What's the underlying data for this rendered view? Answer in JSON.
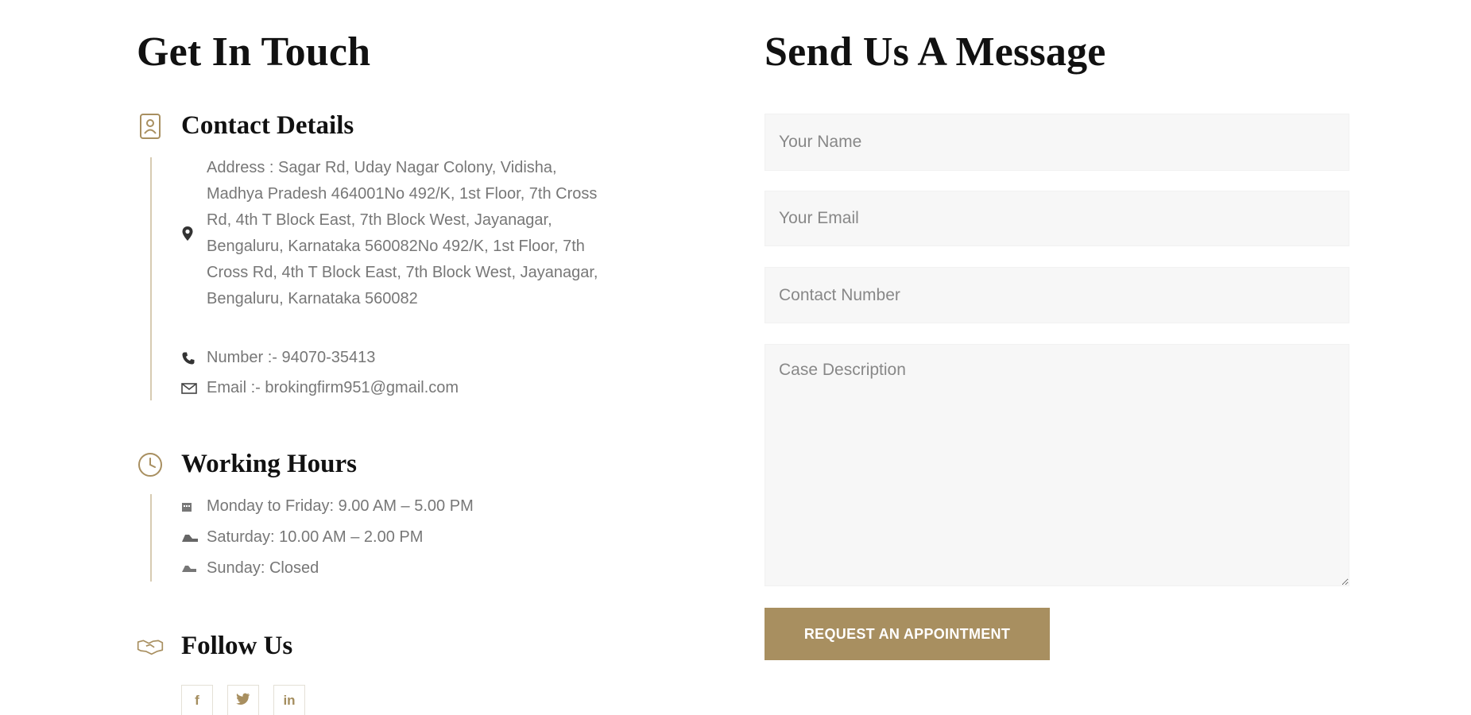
{
  "left": {
    "title": "Get In Touch",
    "contact": {
      "heading": "Contact Details",
      "address": "Address : Sagar Rd, Uday Nagar Colony, Vidisha, Madhya Pradesh 464001No 492/K, 1st Floor, 7th Cross Rd, 4th T Block East, 7th Block West, Jayanagar, Bengaluru, Karnataka 560082No 492/K, 1st Floor, 7th Cross Rd, 4th T Block East, 7th Block West, Jayanagar, Bengaluru, Karnataka 560082",
      "phone": "Number :- 94070-35413",
      "email": "Email :- brokingfirm951@gmail.com"
    },
    "hours": {
      "heading": "Working Hours",
      "items": [
        "Monday to Friday: 9.00 AM – 5.00 PM",
        "Saturday: 10.00 AM – 2.00 PM",
        "Sunday: Closed"
      ]
    },
    "follow": {
      "heading": "Follow Us",
      "socials": [
        "f",
        "twitter",
        "in"
      ]
    }
  },
  "right": {
    "title": "Send Us A Message",
    "fields": {
      "name_placeholder": "Your Name",
      "email_placeholder": "Your Email",
      "phone_placeholder": "Contact Number",
      "description_placeholder": "Case Description"
    },
    "submit_label": "REQUEST AN APPOINTMENT"
  },
  "colors": {
    "accent": "#a88f60",
    "heading": "#111111",
    "body_text": "#777777",
    "field_bg": "#f7f7f7"
  },
  "icons": {
    "contact": "contact-card-icon",
    "location": "map-pin-icon",
    "phone": "phone-icon",
    "email": "mail-icon",
    "hours": "clock-icon",
    "follow": "handshake-icon"
  }
}
